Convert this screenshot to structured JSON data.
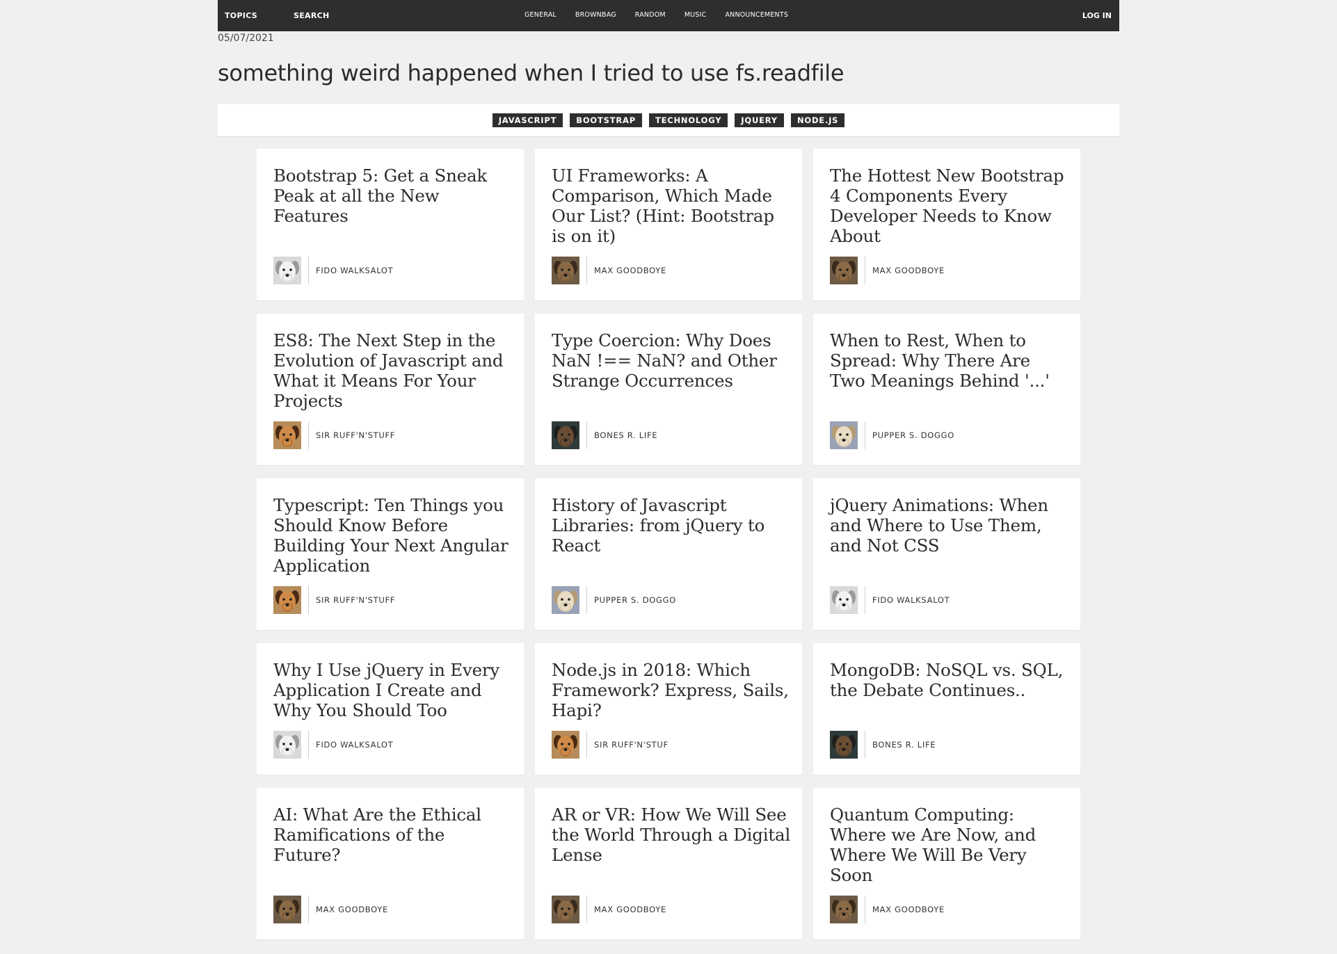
{
  "nav": {
    "topics": "TOPICS",
    "search": "SEARCH",
    "categories": [
      "GENERAL",
      "BROWNBAG",
      "RANDOM",
      "MUSIC",
      "ANNOUNCEMENTS"
    ],
    "login": "LOG IN"
  },
  "post": {
    "date": "05/07/2021",
    "title": "something weird happened when I tried to use fs.readfile",
    "tags": [
      "JAVASCRIPT",
      "BOOTSTRAP",
      "TECHNOLOGY",
      "JQUERY",
      "NODE.JS"
    ]
  },
  "cards": [
    {
      "title": "Bootstrap 5: Get a Sneak Peak at all the New Features",
      "author": "FIDO WALKSALOT",
      "avatar": "white-dog-avatar"
    },
    {
      "title": "UI Frameworks: A Comparison, Which Made Our List? (Hint: Bootstrap is on it)",
      "author": "MAX GOODBOYE",
      "avatar": "brown-dog-avatar"
    },
    {
      "title": "The Hottest New Bootstrap 4 Components Every Developer Needs to Know About",
      "author": "MAX GOODBOYE",
      "avatar": "brown-dog-avatar"
    },
    {
      "title": "ES8: The Next Step in the Evolution of Javascript and What it Means For Your Projects",
      "author": "SIR RUFF'N'STUFF",
      "avatar": "tan-dog-avatar"
    },
    {
      "title": "Type Coercion: Why Does NaN !== NaN? and Other Strange Occurrences",
      "author": "BONES R. LIFE",
      "avatar": "dark-dog-avatar"
    },
    {
      "title": "When to Rest, When to Spread: Why There Are Two Meanings Behind '...'",
      "author": "PUPPER S. DOGGO",
      "avatar": "cream-dog-avatar"
    },
    {
      "title": "Typescript: Ten Things you Should Know Before Building Your Next Angular Application",
      "author": "SIR RUFF'N'STUFF",
      "avatar": "tan-dog-avatar"
    },
    {
      "title": "History of Javascript Libraries: from jQuery to React",
      "author": "PUPPER S. DOGGO",
      "avatar": "cream-dog-avatar"
    },
    {
      "title": "jQuery Animations: When and Where to Use Them, and Not CSS",
      "author": "FIDO WALKSALOT",
      "avatar": "white-dog-avatar"
    },
    {
      "title": "Why I Use jQuery in Every Application I Create and Why You Should Too",
      "author": "FIDO WALKSALOT",
      "avatar": "white-dog-avatar"
    },
    {
      "title": "Node.js in 2018: Which Framework? Express, Sails, Hapi?",
      "author": "SIR RUFF'N'STUF",
      "avatar": "tan-dog-avatar"
    },
    {
      "title": "MongoDB: NoSQL vs. SQL, the Debate Continues..",
      "author": "BONES R. LIFE",
      "avatar": "dark-dog-avatar"
    },
    {
      "title": "AI: What Are the Ethical Ramifications of the Future?",
      "author": "MAX GOODBOYE",
      "avatar": "brown-dog-avatar"
    },
    {
      "title": "AR or VR: How We Will See the World Through a Digital Lense",
      "author": "MAX GOODBOYE",
      "avatar": "brown-dog-avatar"
    },
    {
      "title": "Quantum Computing: Where we Are Now, and Where We Will Be Very Soon",
      "author": "MAX GOODBOYE",
      "avatar": "brown-dog-avatar"
    }
  ],
  "avatar_colors": {
    "white-dog-avatar": {
      "bg": "#d9d9d9",
      "fur": "#f2f2f2",
      "shade": "#9a9a9a"
    },
    "brown-dog-avatar": {
      "bg": "#6d5a45",
      "fur": "#8a6a45",
      "shade": "#3a2a1c"
    },
    "tan-dog-avatar": {
      "bg": "#b58c5a",
      "fur": "#d08a48",
      "shade": "#4a2a14"
    },
    "dark-dog-avatar": {
      "bg": "#2f3a3a",
      "fur": "#6a4e34",
      "shade": "#1e1e1e"
    },
    "cream-dog-avatar": {
      "bg": "#9aa3b5",
      "fur": "#e8dcc4",
      "shade": "#b59a74"
    }
  }
}
